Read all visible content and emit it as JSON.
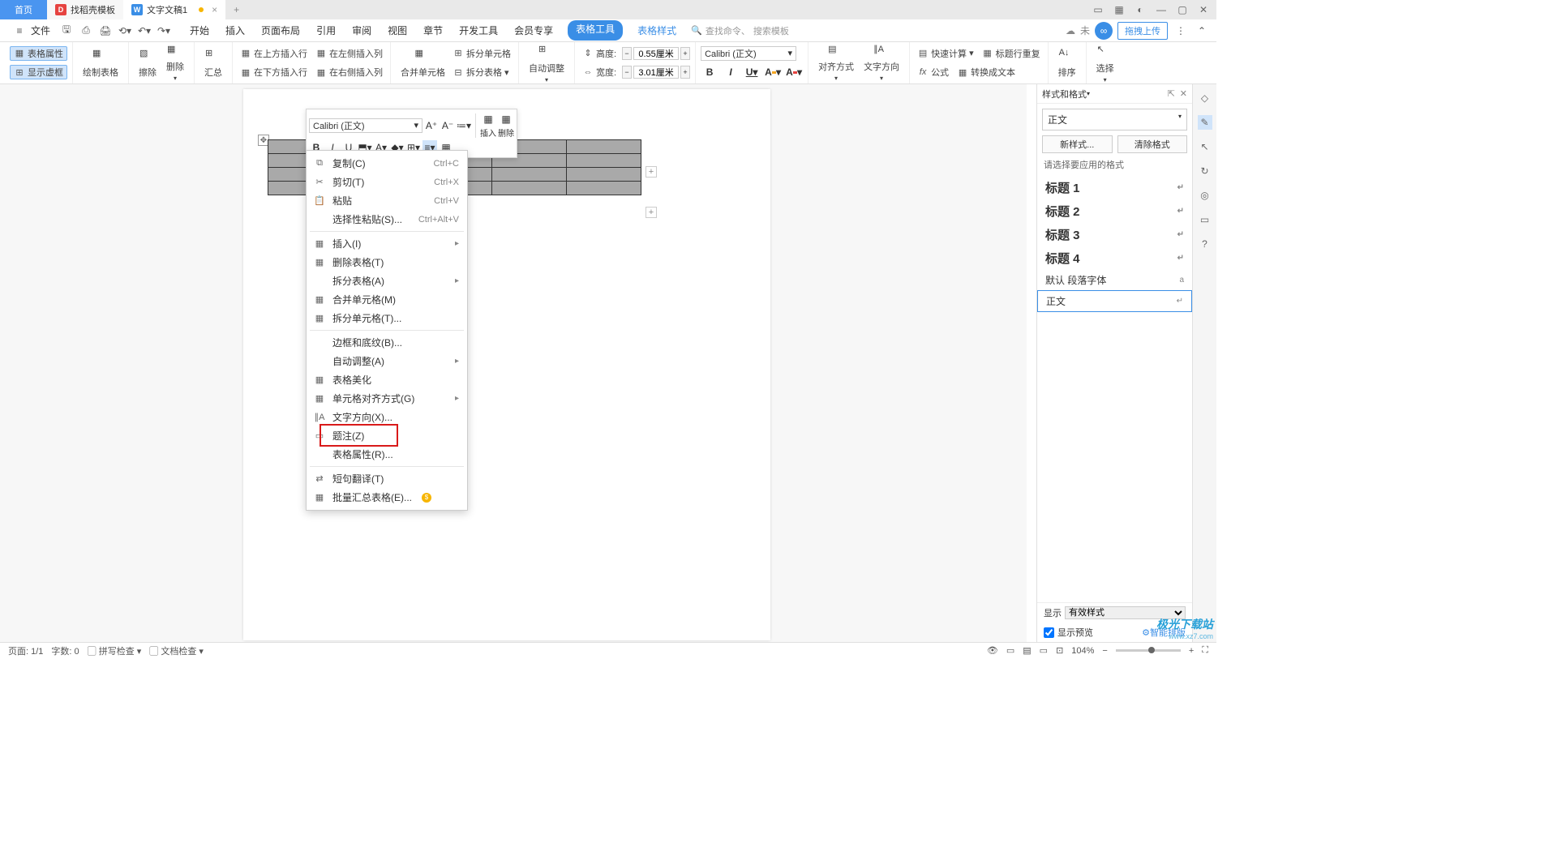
{
  "title_tabs": {
    "home": "首页",
    "template": "找稻壳模板",
    "doc": "文字文稿1"
  },
  "menu": {
    "file": "文件",
    "tabs": [
      "开始",
      "插入",
      "页面布局",
      "引用",
      "审阅",
      "视图",
      "章节",
      "开发工具",
      "会员专享"
    ],
    "table_tool": "表格工具",
    "table_style": "表格样式",
    "search_prefix": "查找命令、",
    "search_placeholder": "搜索模板",
    "unsynced": "未",
    "upload": "拖拽上传"
  },
  "ribbon": {
    "table_props": "表格属性",
    "show_dummy": "显示虚框",
    "draw_table": "绘制表格",
    "erase": "擦除",
    "delete": "删除",
    "summary": "汇总",
    "insert_above": "在上方插入行",
    "insert_below": "在下方插入行",
    "insert_left": "在左侧插入列",
    "insert_right": "在右侧插入列",
    "merge_cells": "合并单元格",
    "split_cells": "拆分单元格",
    "split_table": "拆分表格",
    "auto_fit": "自动调整",
    "height_label": "高度:",
    "width_label": "宽度:",
    "height_value": "0.55厘米",
    "width_value": "3.01厘米",
    "font": "Calibri (正文)",
    "align": "对齐方式",
    "text_dir": "文字方向",
    "quick_calc": "快速计算",
    "header_repeat": "标题行重复",
    "to_text": "转换成文本",
    "formula": "公式",
    "sort": "排序",
    "select": "选择",
    "fx": "fx"
  },
  "mini": {
    "font": "Calibri (正文)",
    "insert": "插入",
    "delete": "删除"
  },
  "ctx": {
    "copy": "复制(C)",
    "cut": "剪切(T)",
    "paste": "粘贴",
    "paste_special": "选择性粘贴(S)...",
    "insert": "插入(I)",
    "delete_table": "删除表格(T)",
    "split_table": "拆分表格(A)",
    "merge_cells": "合并单元格(M)",
    "split_cells": "拆分单元格(T)...",
    "border_shading": "边框和底纹(B)...",
    "auto_fit": "自动调整(A)",
    "beautify": "表格美化",
    "cell_align": "单元格对齐方式(G)",
    "text_dir": "文字方向(X)...",
    "caption": "题注(Z)",
    "table_props": "表格属性(R)...",
    "phrase_trans": "短句翻译(T)",
    "batch_summary": "批量汇总表格(E)...",
    "sc_copy": "Ctrl+C",
    "sc_cut": "Ctrl+X",
    "sc_paste": "Ctrl+V",
    "sc_paste_special": "Ctrl+Alt+V"
  },
  "panel": {
    "title": "样式和格式",
    "current": "正文",
    "new_style": "新样式...",
    "clear_format": "清除格式",
    "hint": "请选择要应用的格式",
    "heading1": "标题 1",
    "heading2": "标题 2",
    "heading3": "标题 3",
    "heading4": "标题 4",
    "default_font": "默认 段落字体",
    "body": "正文",
    "show_label": "显示",
    "show_value": "有效样式",
    "preview": "显示预览",
    "smart": "智能排版"
  },
  "status": {
    "page": "页面: 1/1",
    "words": "字数: 0",
    "spell": "拼写检查",
    "doc_check": "文档检查",
    "zoom": "104%"
  },
  "watermark": {
    "line1": "极光下载站",
    "line2": "www.xz7.com"
  }
}
